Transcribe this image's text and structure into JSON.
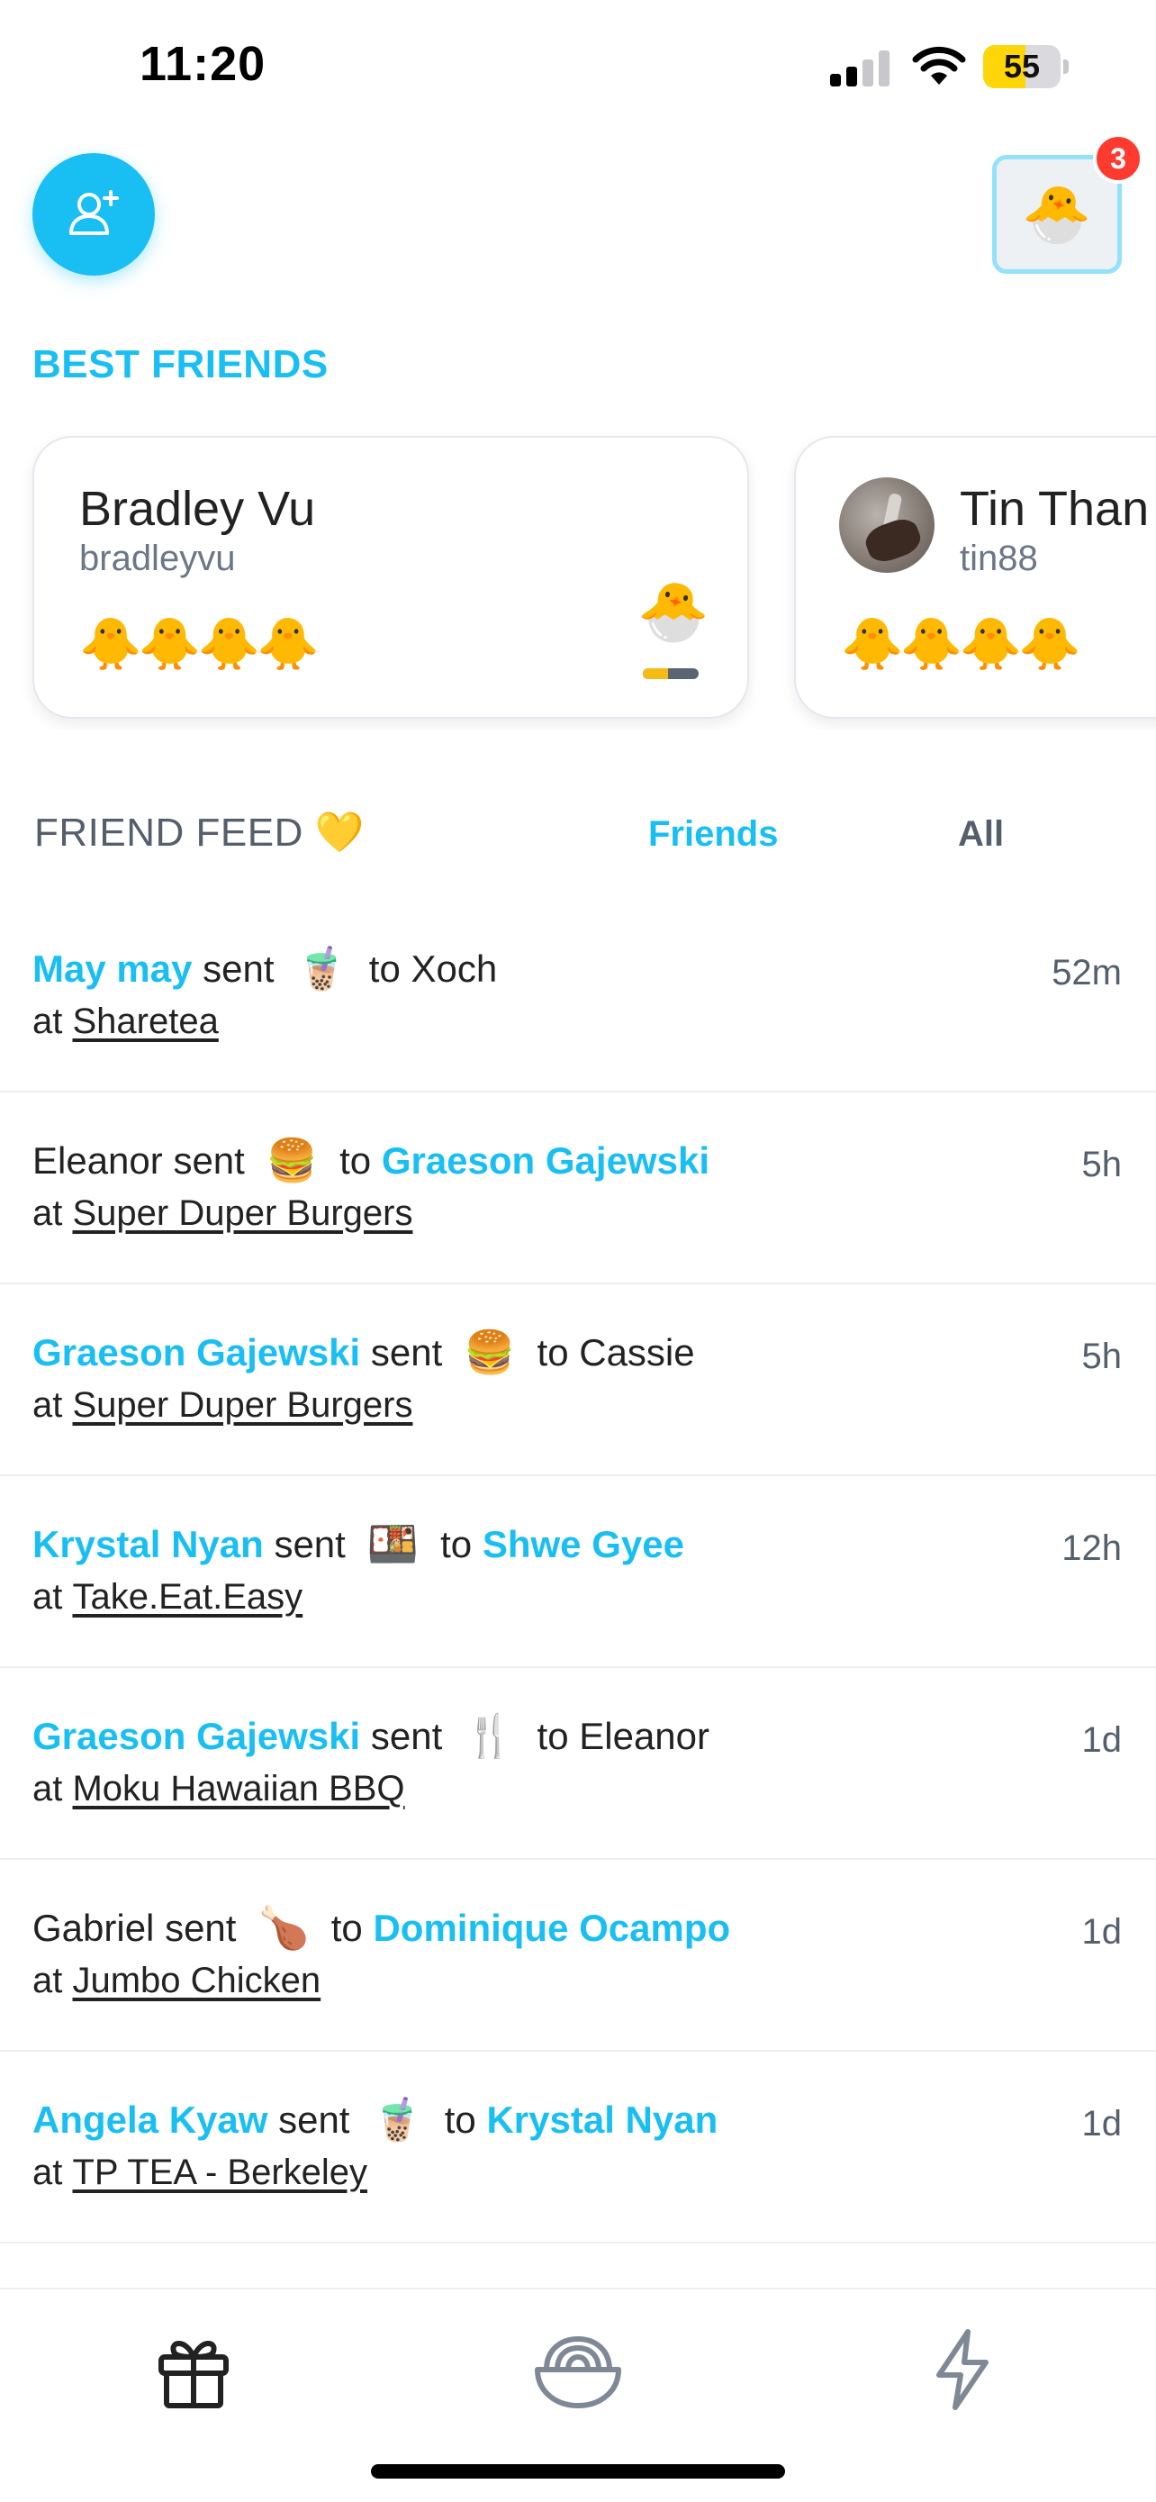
{
  "status_bar": {
    "time": "11:20",
    "battery_level": "55",
    "battery_fraction": 0.55,
    "signal_bars": 2,
    "signal_bars_total": 4,
    "battery_color": "#ffd60a"
  },
  "header": {
    "add_friend_icon": "add-person-icon",
    "profile_emoji": "🐣",
    "notification_count": "3"
  },
  "best_friends": {
    "title": "BEST FRIENDS",
    "cards": [
      {
        "name": "Bradley Vu",
        "username": "bradleyvu",
        "chicks": "🐥🐥🐥🐥",
        "egg": "🐣",
        "progress": 0.45
      },
      {
        "name": "Tin Than",
        "username": "tin88",
        "chicks": "🐥🐥🐥🐥"
      }
    ]
  },
  "feed": {
    "title": "FRIEND FEED 💛",
    "tabs": {
      "friends": "Friends",
      "all": "All"
    },
    "sent_word": "sent",
    "to_word": "to",
    "at_word": "at",
    "items": [
      {
        "sender": "May may",
        "sender_highlight": true,
        "gift": "🧋",
        "recipient": "Xoch",
        "recipient_highlight": false,
        "place": "Sharetea",
        "time": "52m"
      },
      {
        "sender": "Eleanor",
        "sender_highlight": false,
        "gift": "🍔",
        "recipient": "Graeson Gajewski",
        "recipient_highlight": true,
        "place": "Super Duper Burgers",
        "time": "5h"
      },
      {
        "sender": "Graeson Gajewski",
        "sender_highlight": true,
        "gift": "🍔",
        "recipient": "Cassie",
        "recipient_highlight": false,
        "place": "Super Duper Burgers",
        "time": "5h"
      },
      {
        "sender": "Krystal Nyan",
        "sender_highlight": true,
        "gift": "🍱",
        "recipient": "Shwe Gyee",
        "recipient_highlight": true,
        "place": "Take.Eat.Easy",
        "time": "12h"
      },
      {
        "sender": "Graeson Gajewski",
        "sender_highlight": true,
        "gift": "🍴",
        "recipient": "Eleanor",
        "recipient_highlight": false,
        "place": "Moku Hawaiian BBQ",
        "time": "1d"
      },
      {
        "sender": "Gabriel",
        "sender_highlight": false,
        "gift": "🍗",
        "recipient": "Dominique Ocampo",
        "recipient_highlight": true,
        "place": "Jumbo Chicken",
        "time": "1d"
      },
      {
        "sender": "Angela Kyaw",
        "sender_highlight": true,
        "gift": "🧋",
        "recipient": "Krystal Nyan",
        "recipient_highlight": true,
        "place": "TP TEA - Berkeley",
        "time": "1d"
      }
    ]
  },
  "bottom_nav": {
    "items": [
      {
        "icon": "gift-icon",
        "active": true
      },
      {
        "icon": "noodle-bowl-icon",
        "active": false
      },
      {
        "icon": "lightning-icon",
        "active": false
      }
    ]
  },
  "colors": {
    "accent": "#19bff3",
    "text_muted": "#555f6c",
    "badge": "#ff3b30"
  }
}
